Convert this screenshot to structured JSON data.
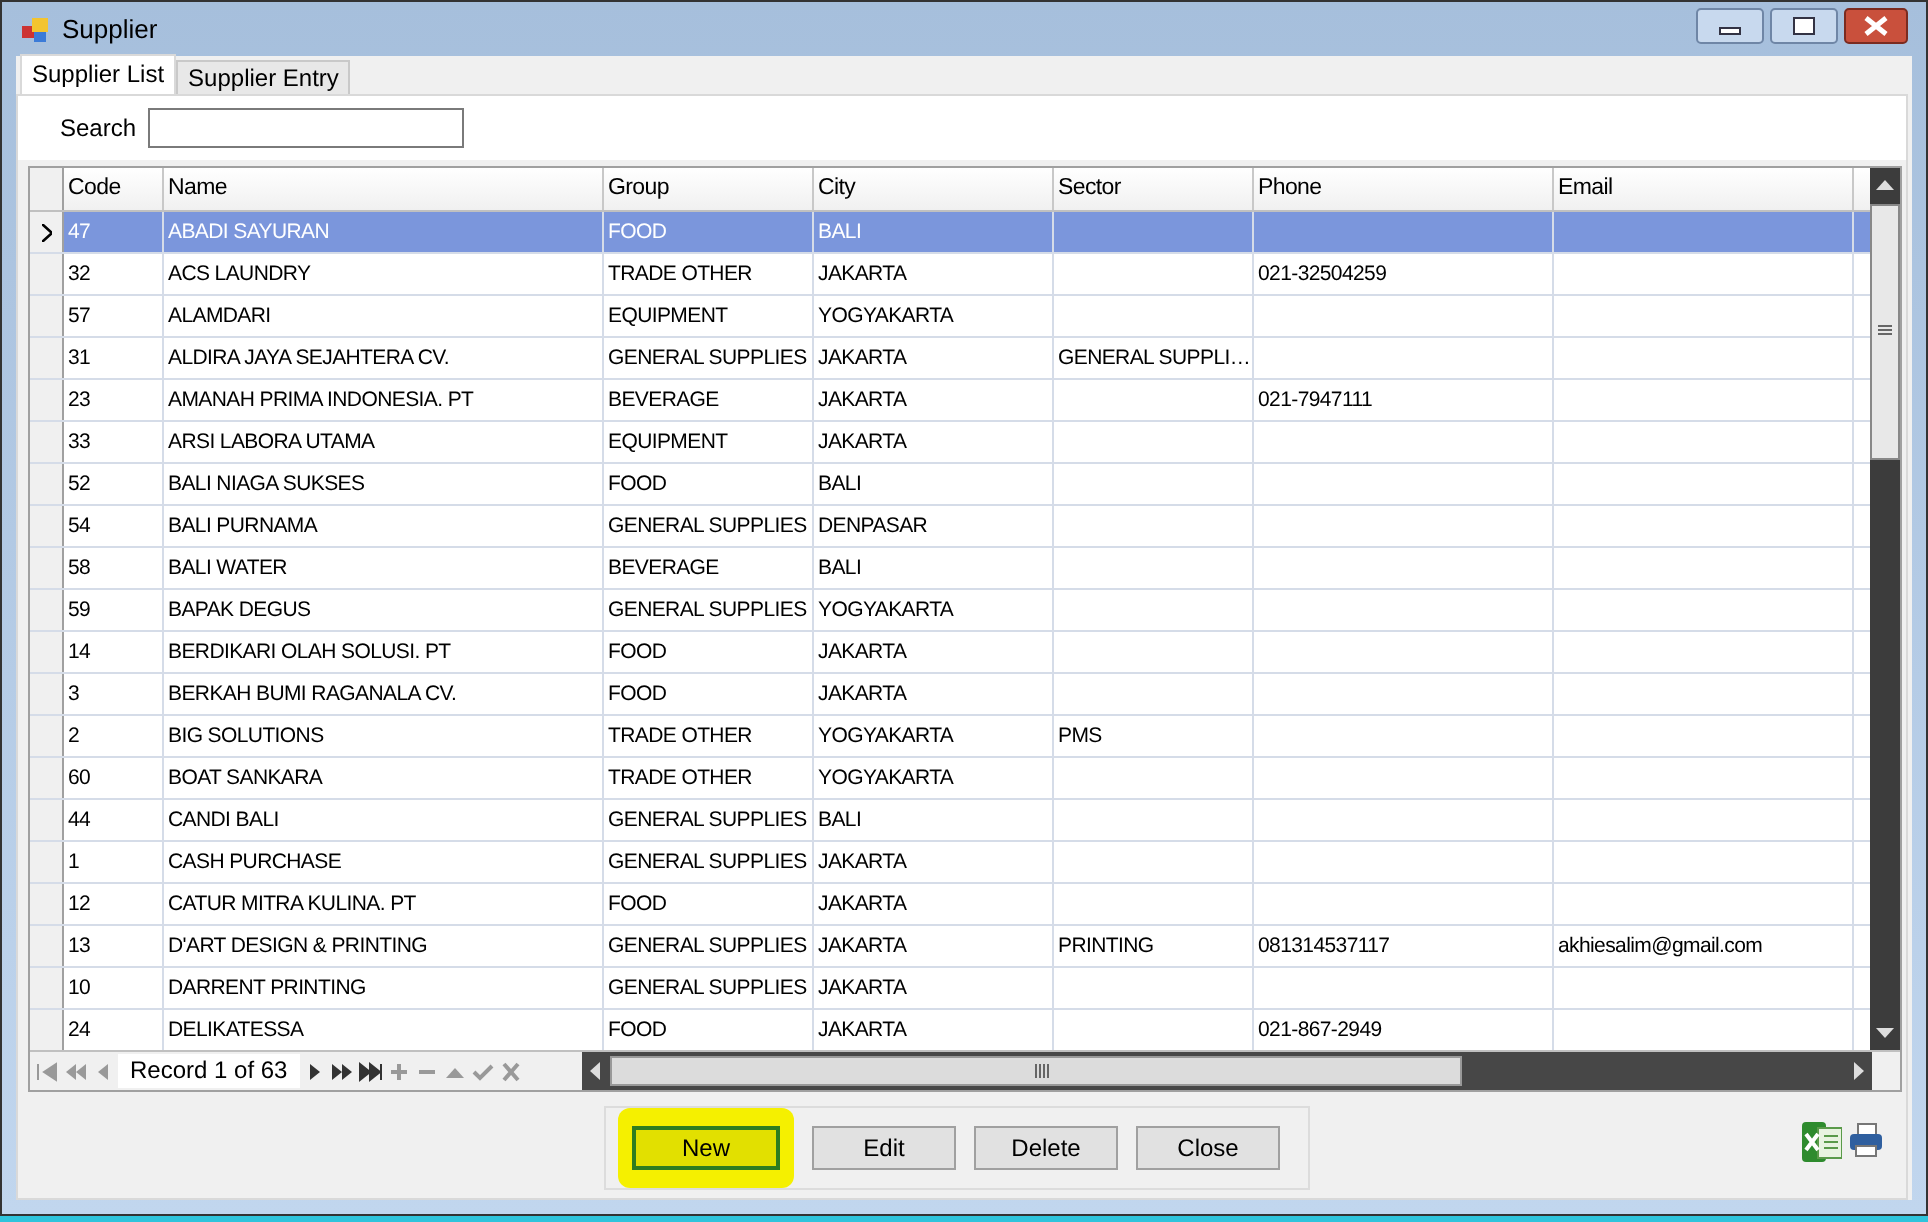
{
  "window": {
    "title": "Supplier"
  },
  "tabs": [
    {
      "label": "Supplier List",
      "selected": true
    },
    {
      "label": "Supplier Entry",
      "selected": false
    }
  ],
  "search": {
    "label": "Search"
  },
  "table": {
    "columns": [
      "Code",
      "Name",
      "Group",
      "City",
      "Sector",
      "Phone",
      "Email"
    ],
    "rows": [
      {
        "selected": true,
        "cells": [
          "47",
          "ABADI SAYURAN",
          "FOOD",
          "BALI",
          "",
          "",
          ""
        ]
      },
      {
        "selected": false,
        "cells": [
          "32",
          "ACS LAUNDRY",
          "TRADE OTHER",
          "JAKARTA",
          "",
          "021-32504259",
          ""
        ]
      },
      {
        "selected": false,
        "cells": [
          "57",
          "ALAMDARI",
          "EQUIPMENT",
          "YOGYAKARTA",
          "",
          "",
          ""
        ]
      },
      {
        "selected": false,
        "cells": [
          "31",
          "ALDIRA JAYA SEJAHTERA CV.",
          "GENERAL SUPPLIES",
          "JAKARTA",
          "GENERAL SUPPLI…",
          "",
          ""
        ]
      },
      {
        "selected": false,
        "cells": [
          "23",
          "AMANAH PRIMA INDONESIA. PT",
          "BEVERAGE",
          "JAKARTA",
          "",
          "021-7947111",
          ""
        ]
      },
      {
        "selected": false,
        "cells": [
          "33",
          "ARSI LABORA UTAMA",
          "EQUIPMENT",
          "JAKARTA",
          "",
          "",
          ""
        ]
      },
      {
        "selected": false,
        "cells": [
          "52",
          "BALI NIAGA SUKSES",
          "FOOD",
          "BALI",
          "",
          "",
          ""
        ]
      },
      {
        "selected": false,
        "cells": [
          "54",
          "BALI PURNAMA",
          "GENERAL SUPPLIES",
          "DENPASAR",
          "",
          "",
          ""
        ]
      },
      {
        "selected": false,
        "cells": [
          "58",
          "BALI WATER",
          "BEVERAGE",
          "BALI",
          "",
          "",
          ""
        ]
      },
      {
        "selected": false,
        "cells": [
          "59",
          "BAPAK DEGUS",
          "GENERAL SUPPLIES",
          "YOGYAKARTA",
          "",
          "",
          ""
        ]
      },
      {
        "selected": false,
        "cells": [
          "14",
          "BERDIKARI OLAH SOLUSI. PT",
          "FOOD",
          "JAKARTA",
          "",
          "",
          ""
        ]
      },
      {
        "selected": false,
        "cells": [
          "3",
          "BERKAH BUMI RAGANALA CV.",
          "FOOD",
          "JAKARTA",
          "",
          "",
          ""
        ]
      },
      {
        "selected": false,
        "cells": [
          "2",
          "BIG SOLUTIONS",
          "TRADE OTHER",
          "YOGYAKARTA",
          "PMS",
          "",
          ""
        ]
      },
      {
        "selected": false,
        "cells": [
          "60",
          "BOAT SANKARA",
          "TRADE OTHER",
          "YOGYAKARTA",
          "",
          "",
          ""
        ]
      },
      {
        "selected": false,
        "cells": [
          "44",
          "CANDI BALI",
          "GENERAL SUPPLIES",
          "BALI",
          "",
          "",
          ""
        ]
      },
      {
        "selected": false,
        "cells": [
          "1",
          "CASH PURCHASE",
          "GENERAL SUPPLIES",
          "JAKARTA",
          "",
          "",
          ""
        ]
      },
      {
        "selected": false,
        "cells": [
          "12",
          "CATUR MITRA KULINA. PT",
          "FOOD",
          "JAKARTA",
          "",
          "",
          ""
        ]
      },
      {
        "selected": false,
        "cells": [
          "13",
          "D'ART DESIGN & PRINTING",
          "GENERAL SUPPLIES",
          "JAKARTA",
          "PRINTING",
          "081314537117",
          "akhiesalim@gmail.com"
        ]
      },
      {
        "selected": false,
        "cells": [
          "10",
          "DARRENT PRINTING",
          "GENERAL SUPPLIES",
          "JAKARTA",
          "",
          "",
          ""
        ]
      },
      {
        "selected": false,
        "cells": [
          "24",
          "DELIKATESSA",
          "FOOD",
          "JAKARTA",
          "",
          "021-867-2949",
          ""
        ]
      }
    ]
  },
  "navigator": {
    "position": "Record 1 of 63"
  },
  "buttons": [
    {
      "label": "New",
      "highlighted": true
    },
    {
      "label": "Edit",
      "highlighted": false
    },
    {
      "label": "Delete",
      "highlighted": false
    },
    {
      "label": "Close",
      "highlighted": false
    }
  ]
}
